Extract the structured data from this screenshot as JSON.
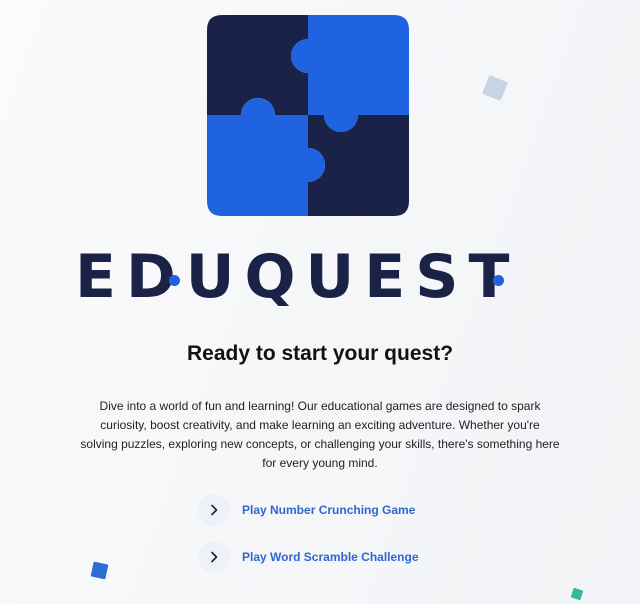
{
  "brand": {
    "name": "EDUQUEST",
    "colors": {
      "navy": "#1a2347",
      "blue": "#1f63e0",
      "link": "#2f66d0"
    },
    "logo_icon": "puzzle-pieces-icon"
  },
  "hero": {
    "headline": "Ready to start your quest?",
    "intro": "Dive into a world of fun and learning! Our educational games are designed to spark curiosity, boost creativity, and make learning an exciting adventure. Whether you're solving puzzles, exploring new concepts, or challenging your skills, there's something here for every young mind."
  },
  "actions": [
    {
      "label": "Play Number Crunching Game",
      "icon": "chevron-right-icon"
    },
    {
      "label": "Play Word Scramble Challenge",
      "icon": "chevron-right-icon"
    }
  ]
}
